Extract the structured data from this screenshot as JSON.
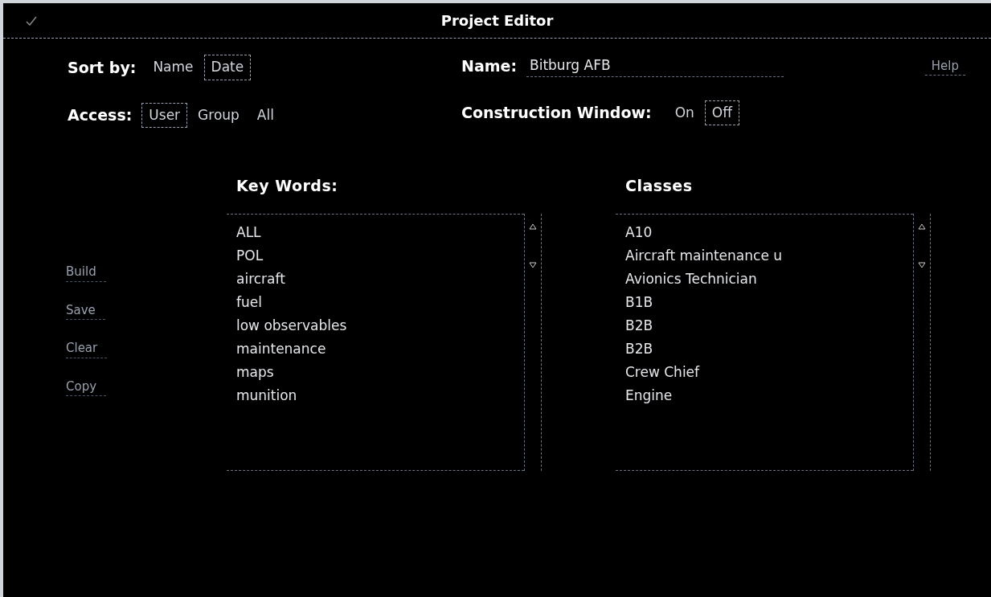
{
  "window": {
    "title": "Project Editor"
  },
  "sort_by": {
    "label": "Sort by:",
    "options": [
      {
        "label": "Name",
        "selected": false
      },
      {
        "label": "Date",
        "selected": true
      }
    ]
  },
  "name_field": {
    "label": "Name:",
    "value": "Bitburg AFB"
  },
  "help_button": "Help",
  "access": {
    "label": "Access:",
    "options": [
      {
        "label": "User",
        "selected": true
      },
      {
        "label": "Group",
        "selected": false
      },
      {
        "label": "All",
        "selected": false
      }
    ]
  },
  "construction_window": {
    "label": "Construction Window:",
    "options": [
      {
        "label": "On",
        "selected": false
      },
      {
        "label": "Off",
        "selected": true
      }
    ]
  },
  "actions": [
    "Build",
    "Save",
    "Clear",
    "Copy"
  ],
  "key_words": {
    "title": "Key Words:",
    "items": [
      "ALL",
      "POL",
      "aircraft",
      "fuel",
      "low observables",
      "maintenance",
      "maps",
      "munition"
    ]
  },
  "classes": {
    "title": "Classes",
    "items": [
      "A10",
      "Aircraft maintenance u",
      "Avionics Technician",
      "B1B",
      "B2B",
      "B2B",
      "Crew Chief",
      "Engine"
    ]
  }
}
